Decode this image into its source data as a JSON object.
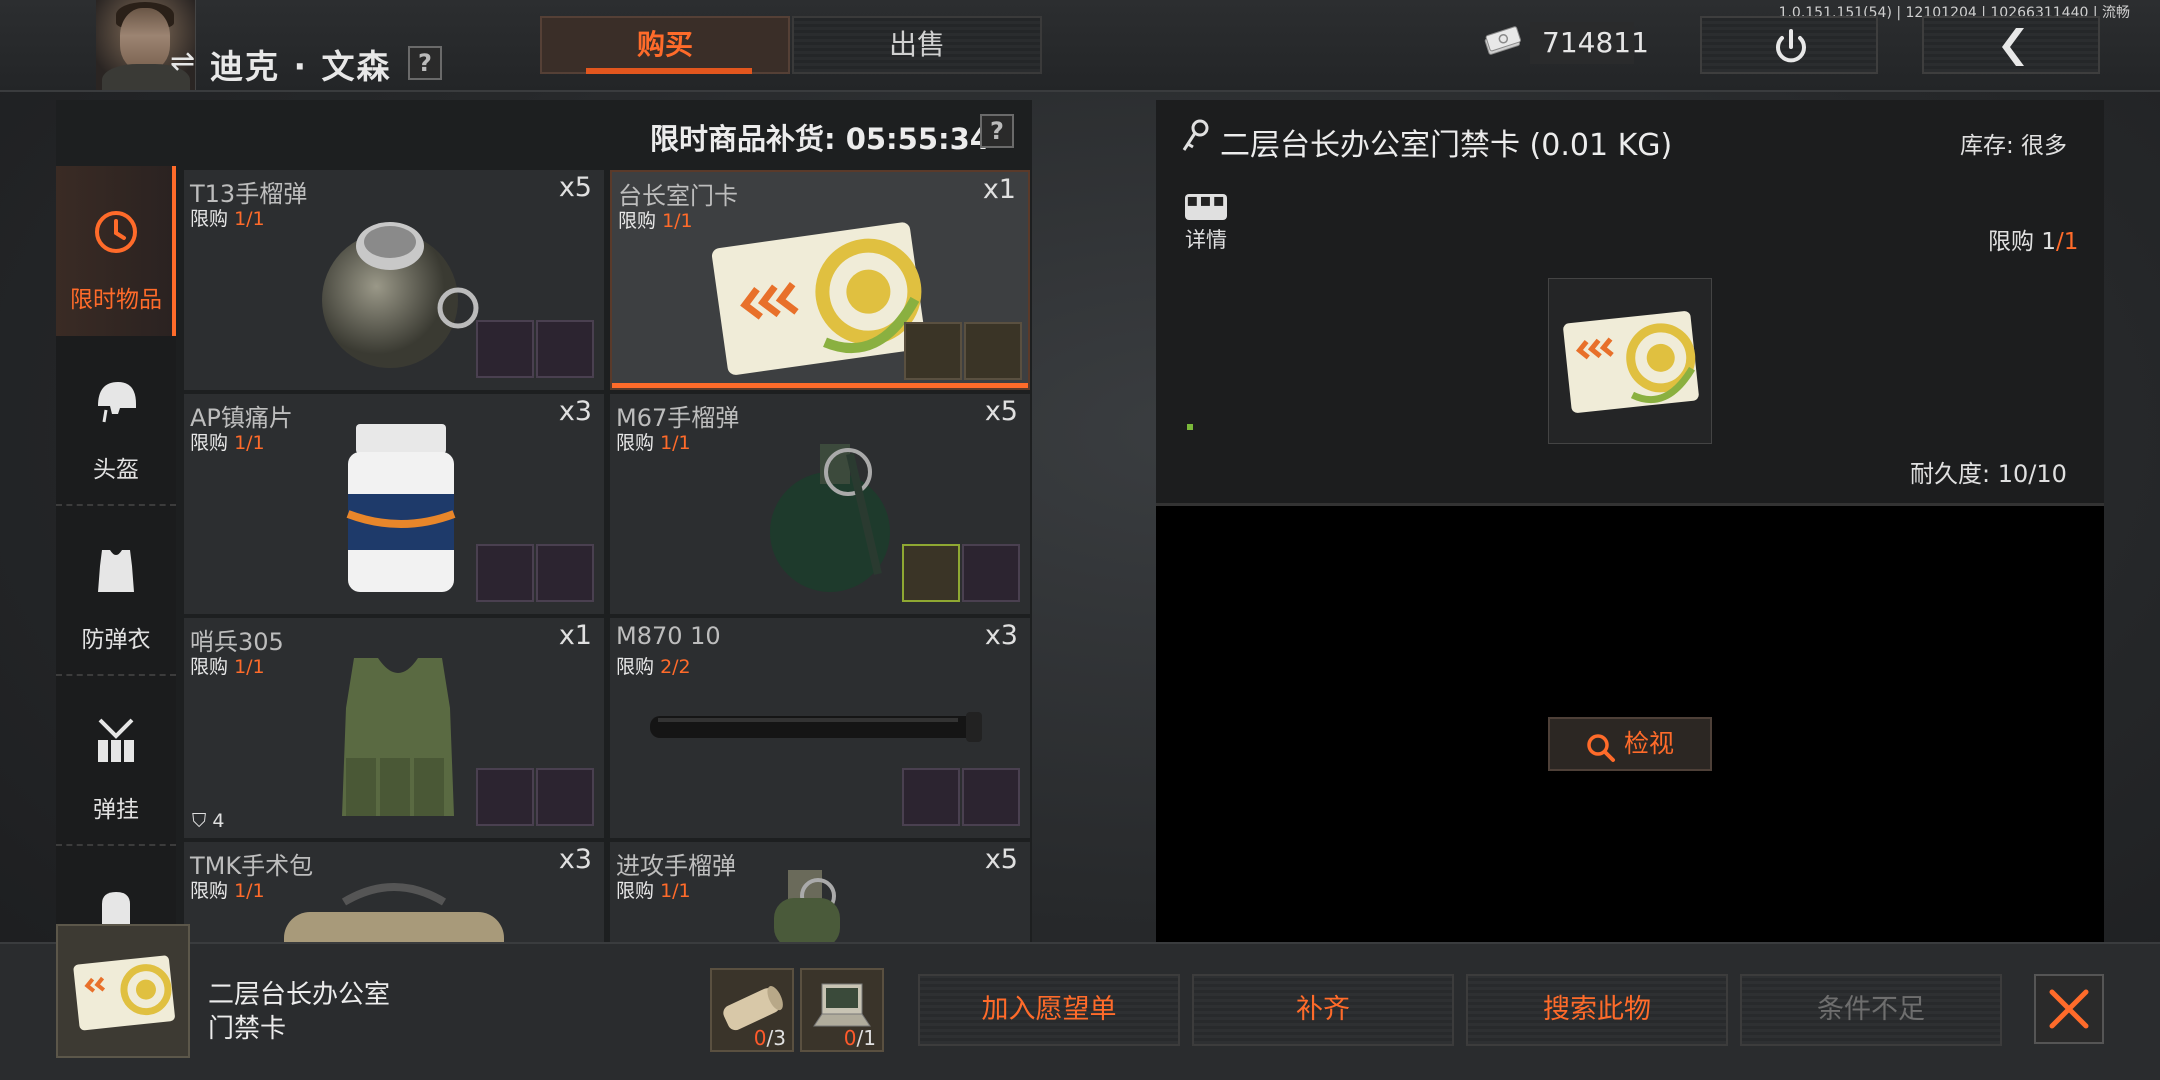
{
  "header": {
    "character_name": "迪克 · 文森",
    "tabs": [
      {
        "label": "购买",
        "active": true
      },
      {
        "label": "出售",
        "active": false
      }
    ],
    "cash": "714811",
    "version": "1.0.151.151(54) | 12101204 | 10266311440 | 流畅",
    "help_label": "?"
  },
  "shop": {
    "restock_label": "限时商品补货: 05:55:34",
    "categories": [
      {
        "label": "限时物品",
        "icon": "clock-icon",
        "active": true
      },
      {
        "label": "头盔",
        "icon": "helmet-icon",
        "active": false
      },
      {
        "label": "防弹衣",
        "icon": "vest-icon",
        "active": false
      },
      {
        "label": "弹挂",
        "icon": "chest-rig-icon",
        "active": false
      },
      {
        "label": "",
        "icon": "backpack-icon",
        "active": false
      }
    ],
    "items": [
      {
        "name": "T13手榴弹",
        "limit_prefix": "限购",
        "limit": "1/1",
        "qty": "x5",
        "icon": "round-grenade"
      },
      {
        "name": "台长室门卡",
        "limit_prefix": "限购",
        "limit": "1/1",
        "qty": "x1",
        "icon": "keycard",
        "selected": true
      },
      {
        "name": "AP镇痛片",
        "limit_prefix": "限购",
        "limit": "1/1",
        "qty": "x3",
        "icon": "pill-bottle"
      },
      {
        "name": "M67手榴弹",
        "limit_prefix": "限购",
        "limit": "1/1",
        "qty": "x5",
        "icon": "m67-grenade"
      },
      {
        "name": "哨兵305",
        "limit_prefix": "限购",
        "limit": "1/1",
        "qty": "x1",
        "icon": "vest",
        "armor_level": "4"
      },
      {
        "name": "M870 10",
        "limit_prefix": "限购",
        "limit": "2/2",
        "qty": "x3",
        "icon": "tube"
      },
      {
        "name": "TMK手术包",
        "limit_prefix": "限购",
        "limit": "1/1",
        "qty": "x3",
        "icon": "medkit"
      },
      {
        "name": "进攻手榴弹",
        "limit_prefix": "限购",
        "limit": "1/1",
        "qty": "x5",
        "icon": "offensive-grenade"
      }
    ]
  },
  "detail": {
    "title": "二层台长办公室门禁卡 (0.01 KG)",
    "stock": "库存: 很多",
    "details_label": "详情",
    "limit_prefix": "限购 ",
    "limit_value": "1",
    "limit_total": "/1",
    "durability": "耐久度: 10/10",
    "inspect_label": "检视"
  },
  "footer": {
    "item_name": "二层台长办公室门禁卡",
    "requirements": [
      {
        "icon": "paper-roll-icon",
        "have": "0",
        "need": "/3"
      },
      {
        "icon": "laptop-icon",
        "have": "0",
        "need": "/1"
      }
    ],
    "buttons": [
      {
        "label": "加入愿望单",
        "disabled": false
      },
      {
        "label": "补齐",
        "disabled": false
      },
      {
        "label": "搜索此物",
        "disabled": false
      },
      {
        "label": "条件不足",
        "disabled": true
      }
    ]
  },
  "colors": {
    "accent": "#ff6b2a",
    "panel": "#1d1f20",
    "card": "#2c2e30"
  }
}
